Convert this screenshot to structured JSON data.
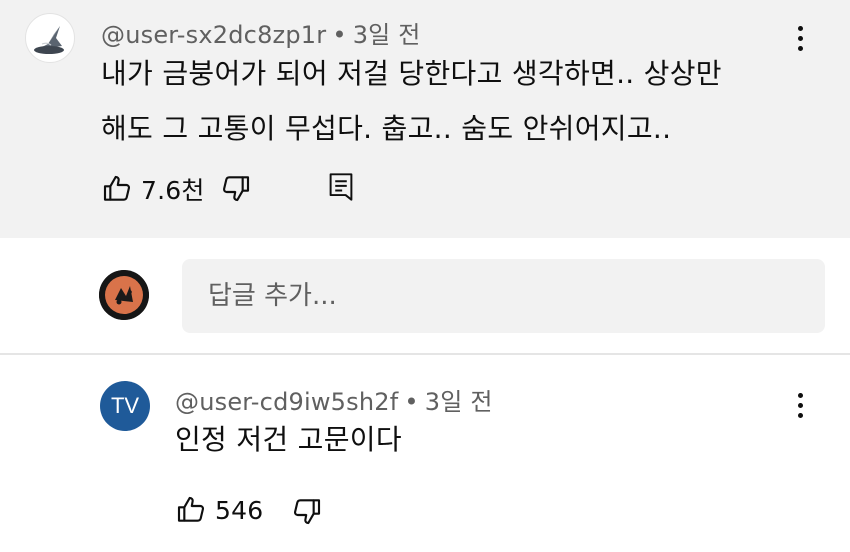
{
  "top_comment": {
    "author": "@user-sx2dc8zp1r",
    "separator": "•",
    "time": "3일 전",
    "text_line1": "내가 금붕어가 되어 저걸 당한다고 생각하면.. 상상만",
    "text_line2": "해도 그 고통이 무섭다. 춥고.. 숨도 안쉬어지고..",
    "likes": "7.6천",
    "avatar_icon": "wizard-hat-icon"
  },
  "reply_box": {
    "placeholder": "답글 추가..."
  },
  "reply_comment": {
    "author": "@user-cd9iw5sh2f",
    "separator": "•",
    "time": "3일 전",
    "text": "인정 저건 고문이다",
    "likes": "546",
    "avatar_label": "TV"
  },
  "colors": {
    "highlight_bg": "#f2f2f2",
    "secondary_text": "#606060",
    "tv_avatar": "#1f5a99",
    "my_avatar_accent": "#e07a4f"
  }
}
